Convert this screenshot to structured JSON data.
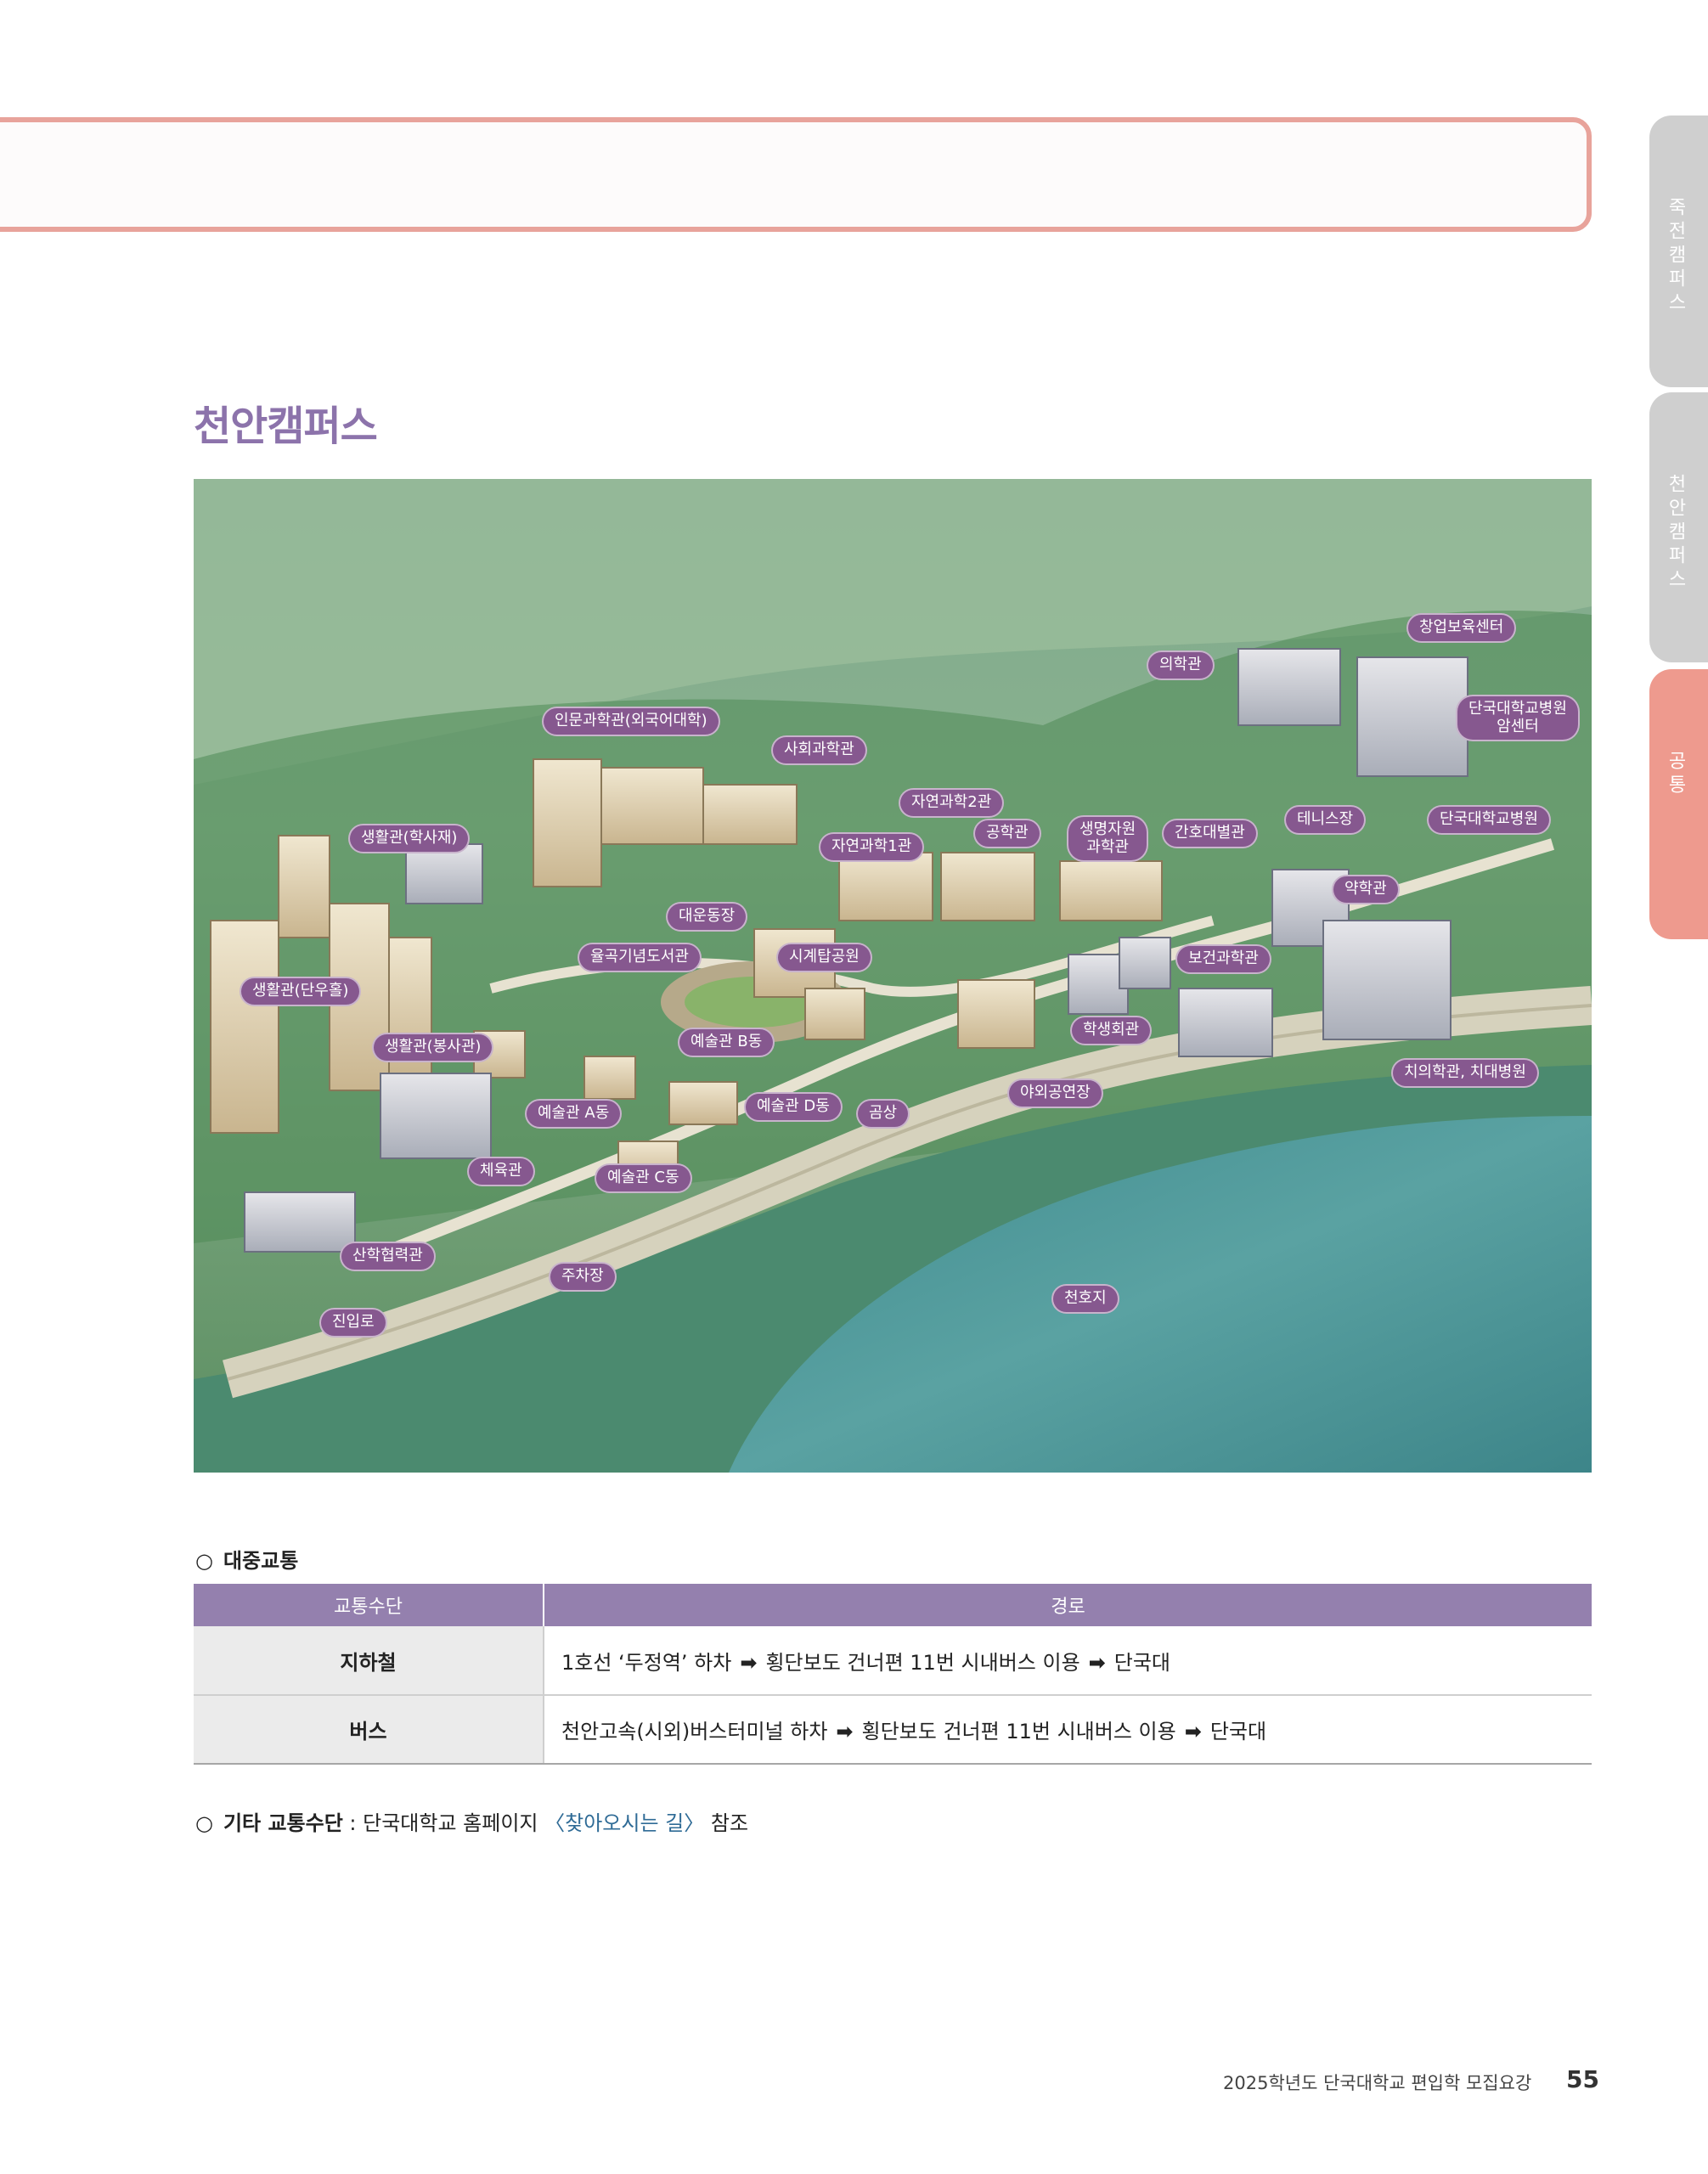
{
  "side_tabs": [
    "죽전캠퍼스",
    "천안캠퍼스",
    "공통"
  ],
  "section_title": "천안캠퍼스",
  "map": {
    "labels": [
      "창업보육센터",
      "의학관",
      "단국대학교병원\n암센터",
      "인문과학관(외국어대학)",
      "사회과학관",
      "자연과학2관",
      "생활관(학사재)",
      "자연과학1관",
      "공학관",
      "생명자원\n과학관",
      "간호대별관",
      "테니스장",
      "단국대학교병원",
      "약학관",
      "대운동장",
      "율곡기념도서관",
      "시계탑공원",
      "보건과학관",
      "생활관(단우홀)",
      "학생회관",
      "생활관(봉사관)",
      "예술관 B동",
      "치의학관, 치대병원",
      "야외공연장",
      "예술관 A동",
      "예술관 D동",
      "곰상",
      "체육관",
      "예술관 C동",
      "산학협력관",
      "주차장",
      "천호지",
      "진입로"
    ]
  },
  "transit": {
    "heading": "대중교통",
    "columns": [
      "교통수단",
      "경로"
    ],
    "arrow": "➡",
    "rows": [
      {
        "mode": "지하철",
        "steps": [
          "1호선 ‘두정역’ 하차",
          "횡단보도 건너편 11번 시내버스 이용",
          "단국대"
        ]
      },
      {
        "mode": "버스",
        "steps": [
          "천안고속(시외)버스터미널 하차",
          "횡단보도 건너편 11번 시내버스 이용",
          "단국대"
        ]
      }
    ]
  },
  "other": {
    "label": "기타 교통수단",
    "sep": " : ",
    "text": "단국대학교 홈페이지 ",
    "link": "〈찾아오시는 길〉",
    "suffix": " 참조"
  },
  "footer": {
    "text": "2025학년도 단국대학교 편입학 모집요강",
    "page": "55"
  },
  "colors": {
    "accent_purple": "#8c73ab",
    "table_header": "#9480ae",
    "pink_border": "#e8a39b",
    "active_tab": "#ee9a8e",
    "label_pill": "#86588f"
  }
}
